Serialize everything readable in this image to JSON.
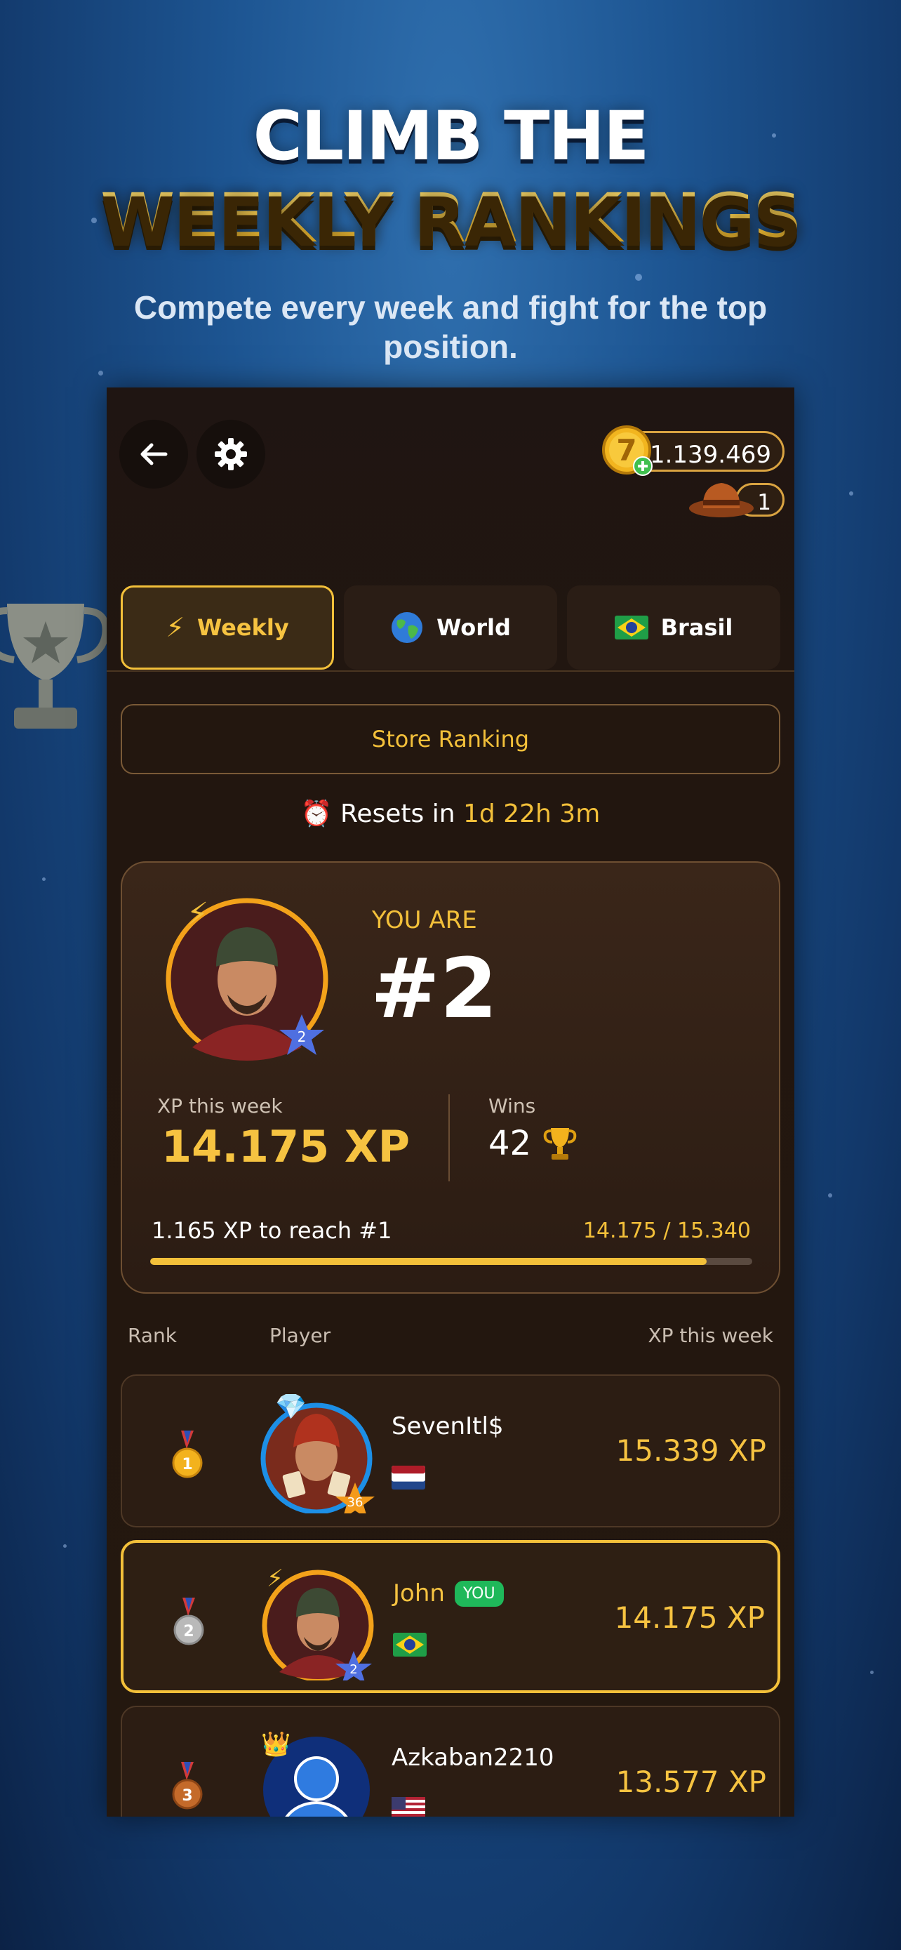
{
  "promo": {
    "title_line1": "CLIMB THE",
    "title_line2": "WEEKLY RANKINGS",
    "subtitle": "Compete every week and fight for the top position."
  },
  "header": {
    "coins": "1.139.469",
    "hats": "1"
  },
  "tabs": [
    {
      "label": "Weekly",
      "icon": "lightning-icon",
      "active": true
    },
    {
      "label": "World",
      "icon": "globe-icon",
      "active": false
    },
    {
      "label": "Brasil",
      "icon": "brazil-flag-icon",
      "active": false
    }
  ],
  "store_ranking_label": "Store Ranking",
  "resets": {
    "label": "Resets in",
    "value": "1d 22h 3m"
  },
  "you_card": {
    "you_are_label": "YOU ARE",
    "rank": "#2",
    "avatar_level": "2",
    "xp_label": "XP this week",
    "xp_value": "14.175 XP",
    "wins_label": "Wins",
    "wins_value": "42",
    "to_reach": "1.165 XP to reach #1",
    "progress_text": "14.175 / 15.340",
    "progress_fraction": 0.924
  },
  "table_header": {
    "rank": "Rank",
    "player": "Player",
    "xp": "XP this week"
  },
  "rows": [
    {
      "rank": "1",
      "name": "SevenItl$",
      "level": "36",
      "xp": "15.339 XP",
      "flag": "netherlands-flag-icon",
      "badge_icon": "diamond-icon",
      "you": false
    },
    {
      "rank": "2",
      "name": "John",
      "you_label": "YOU",
      "level": "2",
      "xp": "14.175 XP",
      "flag": "brazil-flag-icon",
      "badge_icon": "lightning-icon",
      "you": true
    },
    {
      "rank": "3",
      "name": "Azkaban2210",
      "level": "",
      "xp": "13.577 XP",
      "flag": "usa-flag-icon",
      "badge_icon": "crown-icon",
      "you": false
    }
  ],
  "colors": {
    "accent": "#f3c03a",
    "panel_bg": "#22160f",
    "you_badge": "#1fb85a"
  }
}
